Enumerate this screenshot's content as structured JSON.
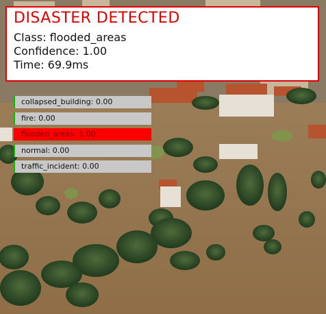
{
  "alert": {
    "title": "DISASTER DETECTED",
    "class_label": "Class:",
    "class_value": "flooded_areas",
    "confidence_label": "Confidence:",
    "confidence_value": "1.00",
    "time_label": "Time:",
    "time_value": "69.9ms"
  },
  "chart_data": {
    "type": "bar",
    "categories": [
      "collapsed_building",
      "fire",
      "flooded_areas",
      "normal",
      "traffic_incident"
    ],
    "values": [
      0.0,
      0.0,
      1.0,
      0.0,
      0.0
    ],
    "labels": [
      "collapsed_building: 0.00",
      "fire: 0.00",
      "flooded_areas: 1.00",
      "normal: 0.00",
      "traffic_incident: 0.00"
    ],
    "ylim": [
      0,
      1
    ],
    "highlight": "flooded_areas"
  },
  "colors": {
    "accent": "#e00000",
    "bar_track": "#c8c8c8",
    "bar_fill_highlight": "#ff0000",
    "bar_fill": "#00c000",
    "flood_water": "#9c7a52"
  }
}
